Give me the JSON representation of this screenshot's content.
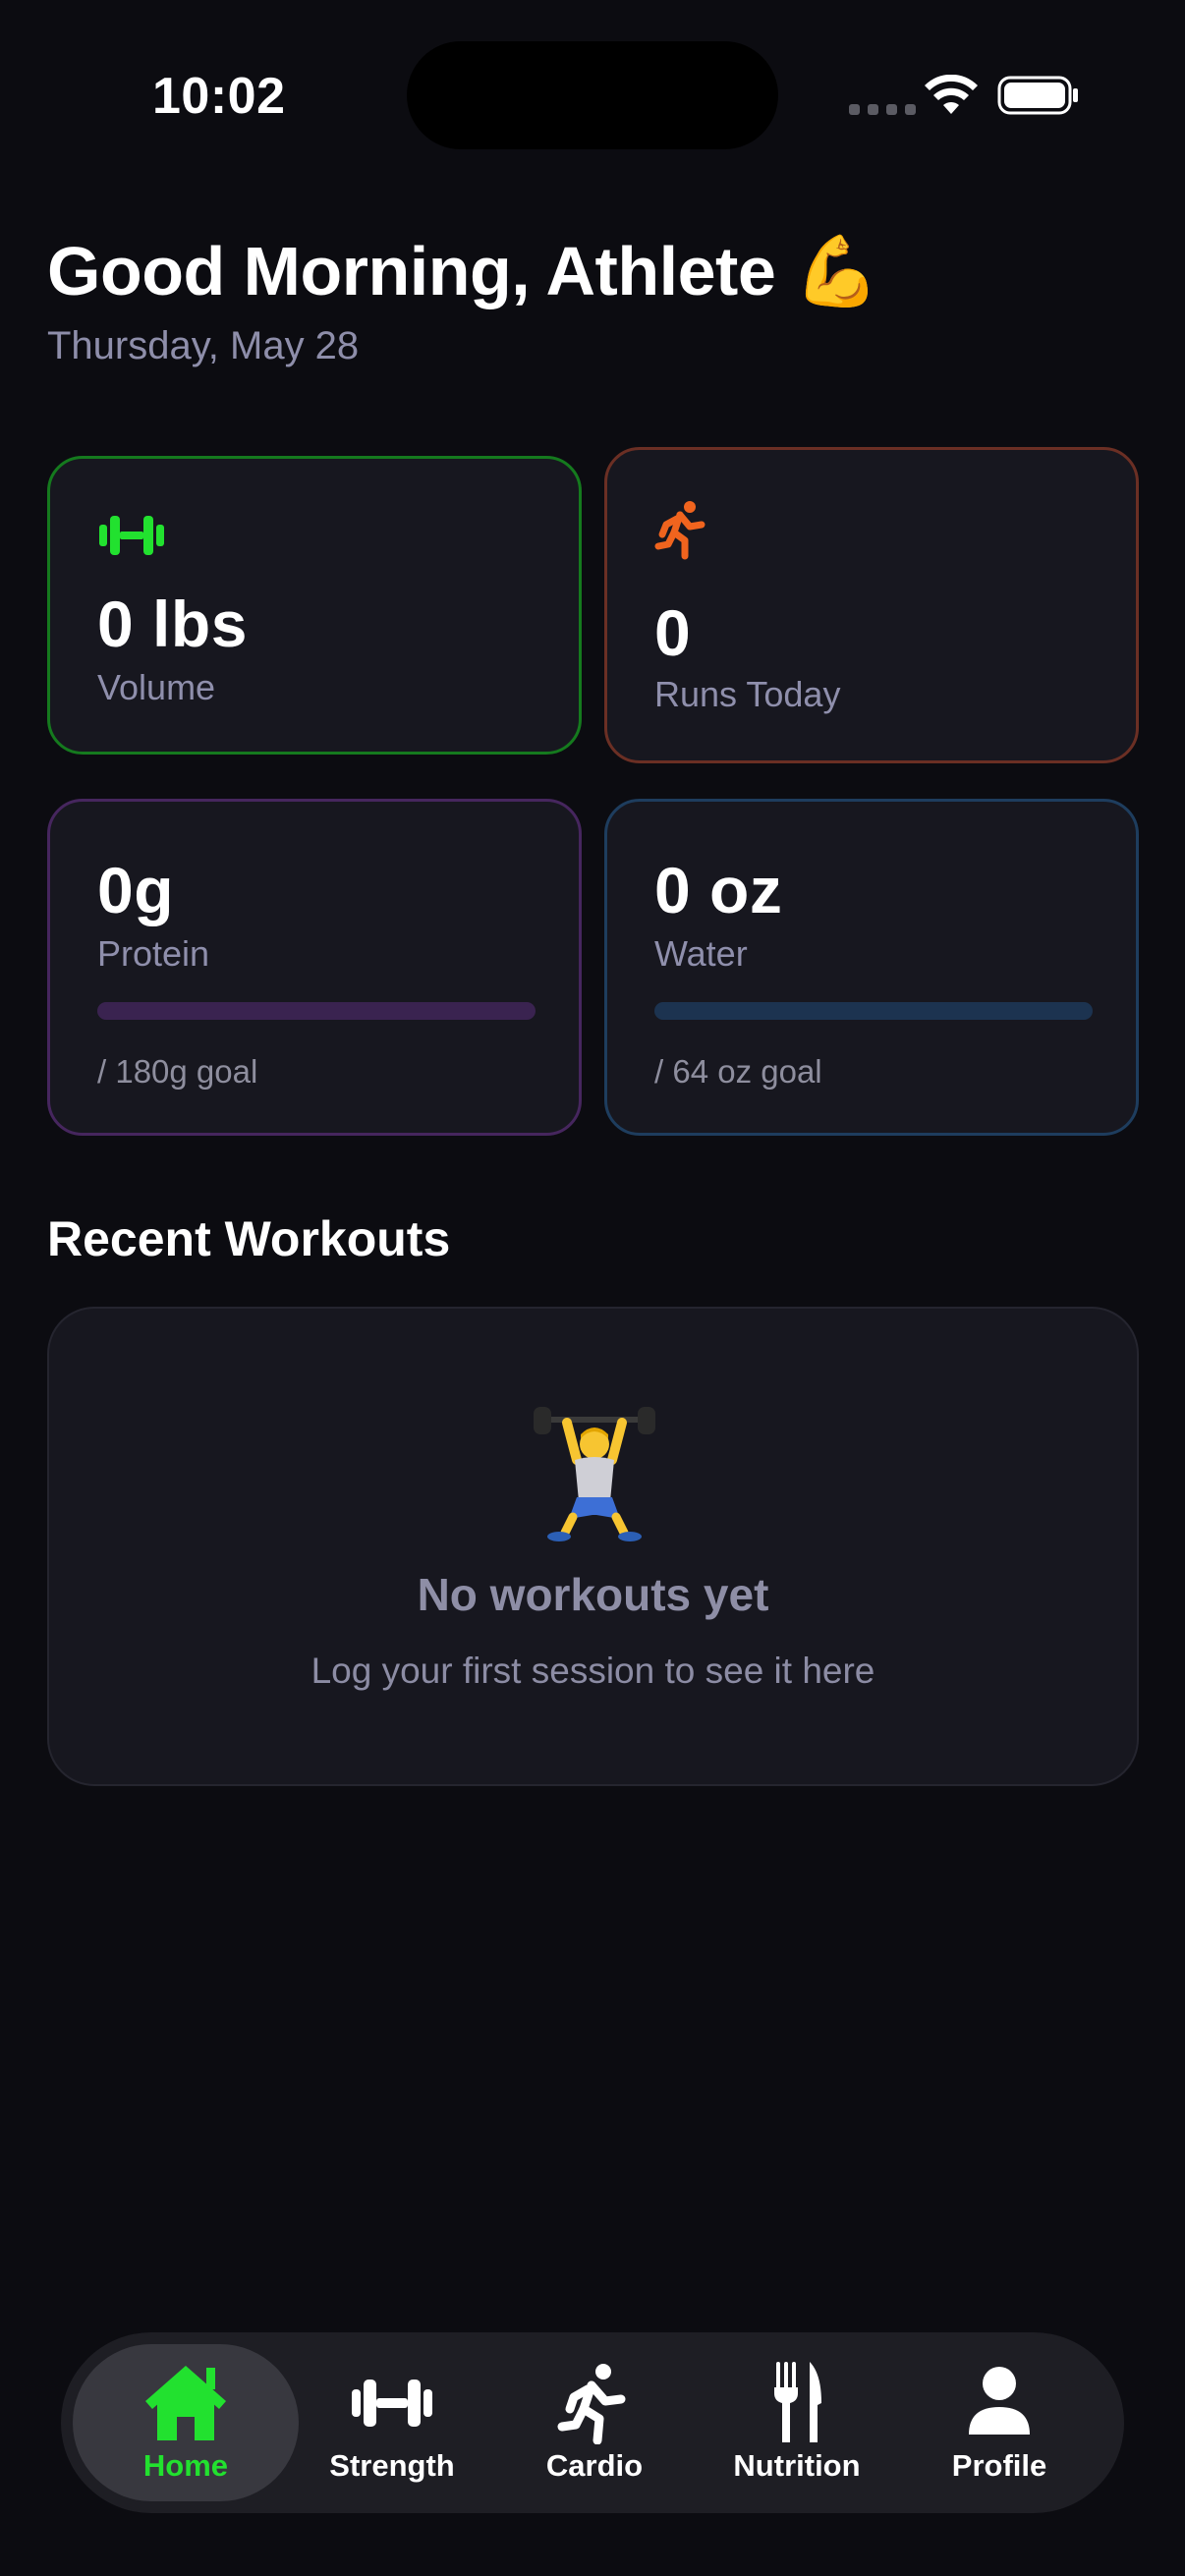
{
  "status_bar": {
    "time": "10:02"
  },
  "header": {
    "greeting": "Good Morning, Athlete",
    "greeting_emoji": "💪",
    "date": "Thursday, May 28"
  },
  "stats": {
    "volume": {
      "value": "0 lbs",
      "label": "Volume",
      "icon": "dumbbell-icon",
      "color": "#22e12f"
    },
    "runs": {
      "value": "0",
      "label": "Runs Today",
      "icon": "runner-icon",
      "color": "#f0641e"
    },
    "protein": {
      "value": "0g",
      "label": "Protein",
      "goal": "/ 180g goal",
      "progress": 0,
      "color": "#3a2350"
    },
    "water": {
      "value": "0 oz",
      "label": "Water",
      "goal": "/ 64 oz goal",
      "progress": 0,
      "color": "#1c3350"
    }
  },
  "recent_workouts": {
    "title": "Recent Workouts",
    "empty_icon": "weightlifter-emoji",
    "empty_title": "No workouts yet",
    "empty_subtitle": "Log your first session to see it here"
  },
  "tab_bar": {
    "active": "Home",
    "accent_color": "#22e12f",
    "tabs": [
      {
        "label": "Home",
        "icon": "home-icon"
      },
      {
        "label": "Strength",
        "icon": "dumbbell-icon"
      },
      {
        "label": "Cardio",
        "icon": "runner-icon"
      },
      {
        "label": "Nutrition",
        "icon": "fork-knife-icon"
      },
      {
        "label": "Profile",
        "icon": "person-icon"
      }
    ]
  }
}
